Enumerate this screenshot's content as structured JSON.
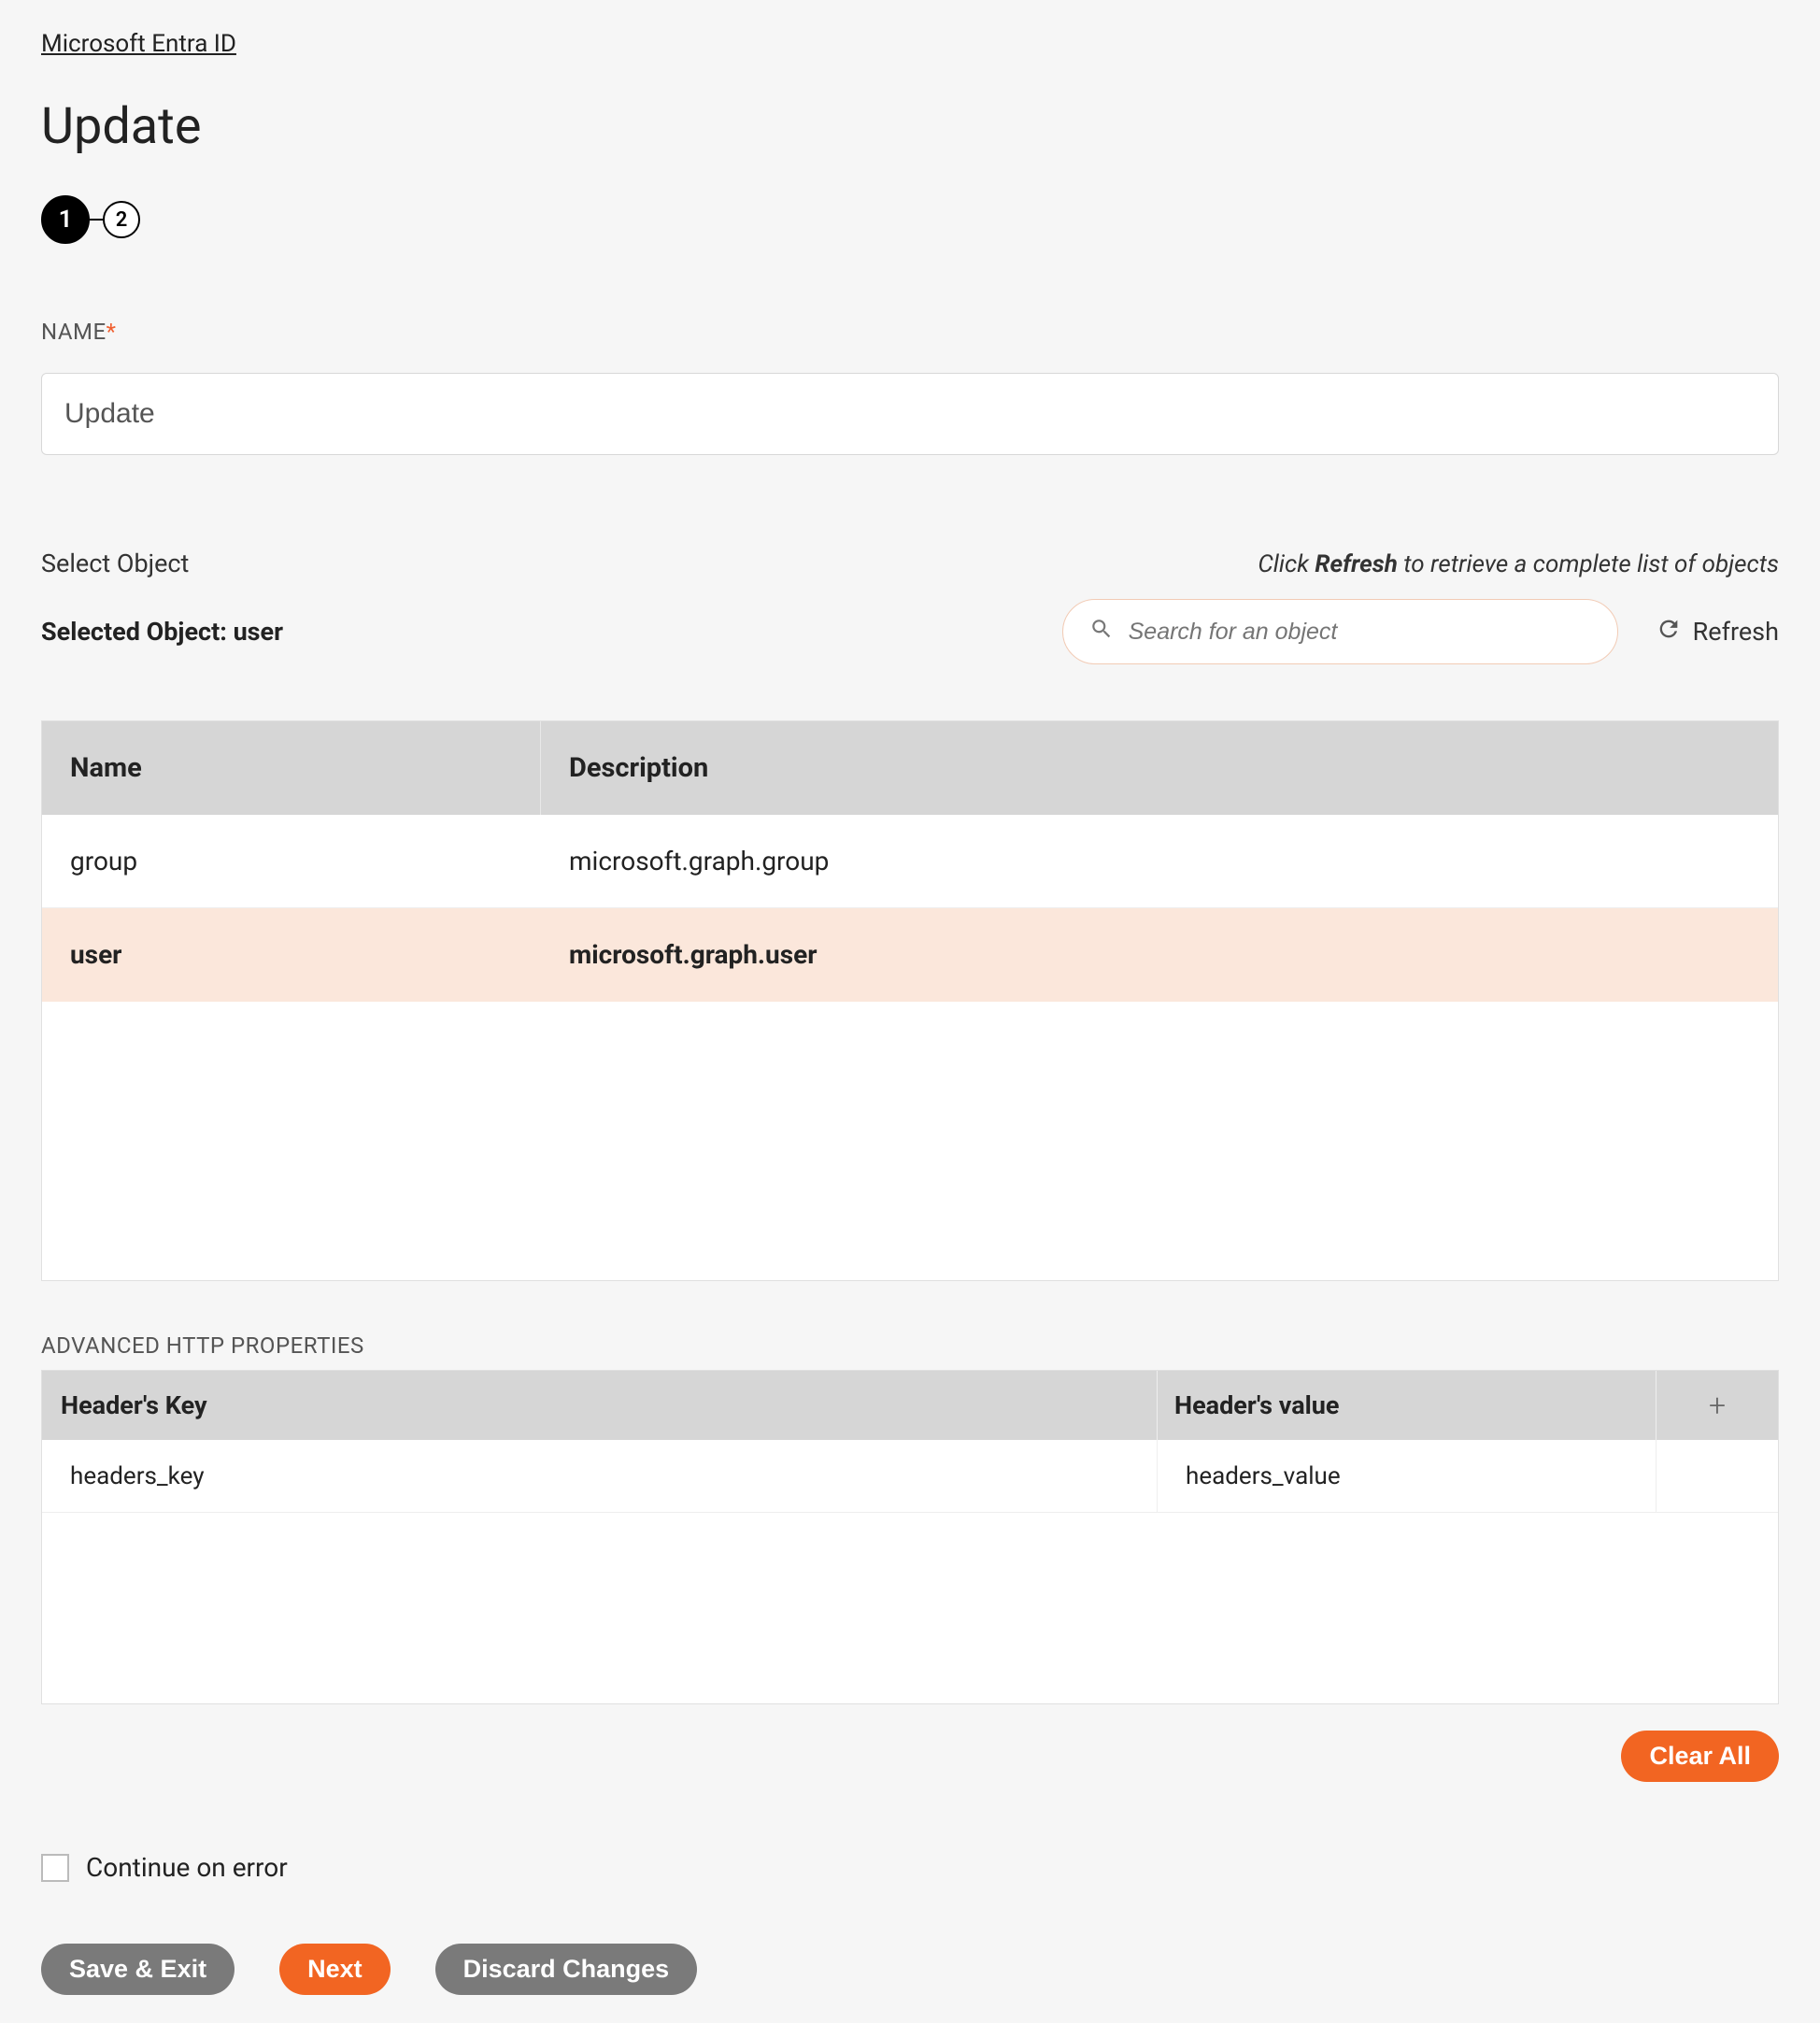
{
  "breadcrumb": "Microsoft Entra ID",
  "page_title": "Update",
  "stepper": {
    "step1": "1",
    "step2": "2"
  },
  "name_field": {
    "label": "NAME",
    "value": "Update"
  },
  "select_object": {
    "label": "Select Object",
    "hint_prefix": "Click ",
    "hint_bold": "Refresh",
    "hint_suffix": " to retrieve a complete list of objects",
    "selected_label_prefix": "Selected Object: ",
    "selected_value": "user",
    "search_placeholder": "Search for an object",
    "refresh_label": "Refresh"
  },
  "objects_table": {
    "col_name": "Name",
    "col_desc": "Description",
    "rows": [
      {
        "name": "group",
        "desc": "microsoft.graph.group",
        "selected": false
      },
      {
        "name": "user",
        "desc": "microsoft.graph.user",
        "selected": true
      }
    ]
  },
  "advanced": {
    "label": "ADVANCED HTTP PROPERTIES",
    "col_key": "Header's Key",
    "col_val": "Header's value",
    "rows": [
      {
        "key": "headers_key",
        "val": "headers_value"
      }
    ]
  },
  "clear_all": "Clear All",
  "continue_on_error": "Continue on error",
  "buttons": {
    "save_exit": "Save & Exit",
    "next": "Next",
    "discard": "Discard Changes"
  }
}
